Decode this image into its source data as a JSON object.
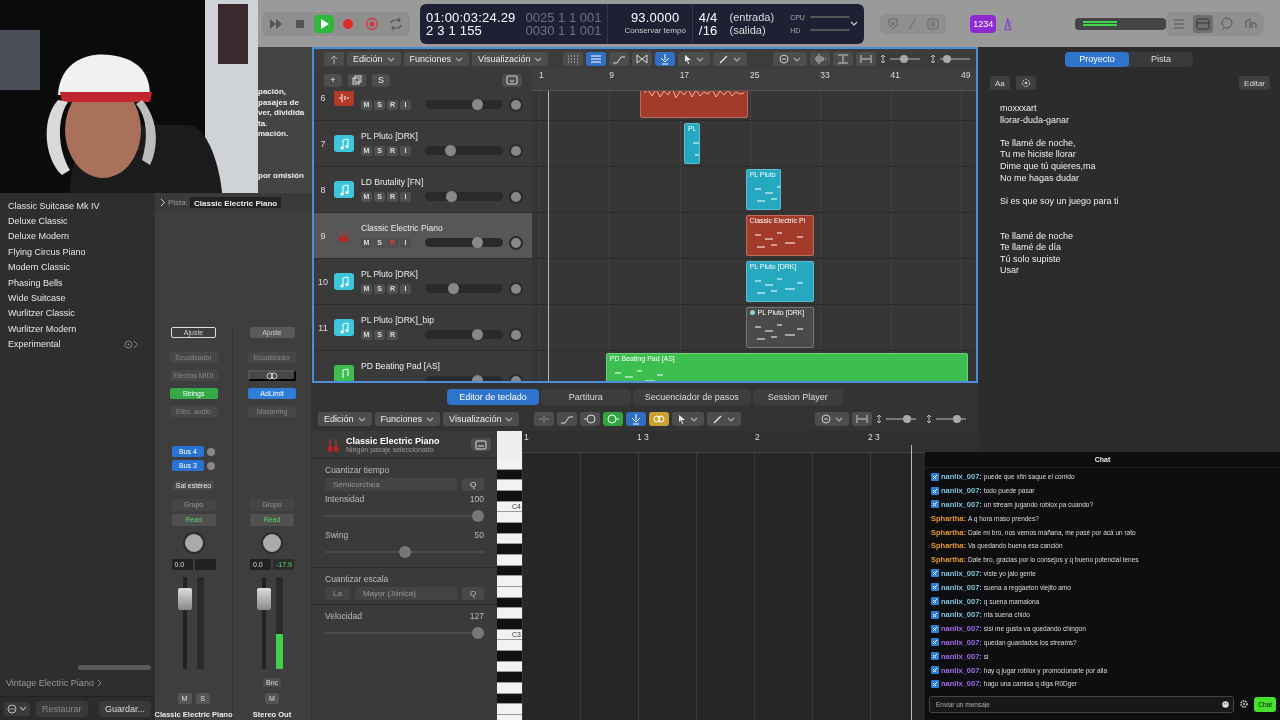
{
  "toolbar": {
    "transport": [
      {
        "kind": "forward",
        "on": false
      },
      {
        "kind": "stop",
        "on": false
      },
      {
        "kind": "play",
        "on": true
      },
      {
        "kind": "record",
        "on": false
      },
      {
        "kind": "capture",
        "on": false
      },
      {
        "kind": "cycle",
        "on": false
      }
    ],
    "lcd": {
      "time": "01:00:03:24.29",
      "position": "2 3 1 155",
      "left_locator": "0025 1 1 001",
      "right_locator": "0030 1 1 001",
      "tempo": "93.0000",
      "tempo_mode": "Conservar tempo",
      "signature": "4/4",
      "division": "/16",
      "input": "(entrada)",
      "output": "(salida)",
      "cpu_label": "CPU",
      "hd_label": "HD"
    },
    "count_in": "1234"
  },
  "library": {
    "items": [
      {
        "label": "Classic Suitcase Mk IV",
        "has_submenu": false
      },
      {
        "label": "Deluxe Classic",
        "has_submenu": false
      },
      {
        "label": "Deluxe Modern",
        "has_submenu": false
      },
      {
        "label": "Flying Circus Piano",
        "has_submenu": false
      },
      {
        "label": "Modern Classic",
        "has_submenu": false
      },
      {
        "label": "Phasing Bells",
        "has_submenu": false
      },
      {
        "label": "Wide Suitcase",
        "has_submenu": false
      },
      {
        "label": "Wurlitzer Classic",
        "has_submenu": false
      },
      {
        "label": "Wurlitzer Modern",
        "has_submenu": false
      },
      {
        "label": "Experimental",
        "has_submenu": true
      }
    ],
    "patch": "Vintage Electric Piano",
    "buttons": [
      {
        "label": "Restaurar",
        "disabled": true
      },
      {
        "label": "Guardar...",
        "disabled": false
      }
    ]
  },
  "inspector": {
    "help_fragments": [
      "pación,",
      "pasajes de",
      "ver, dividida",
      "ta.",
      "mación."
    ],
    "help_default": "por omisión",
    "track_label": "Pista:",
    "track_name": "Classic Electric Piano",
    "strips": [
      {
        "setting": {
          "label": "Ajuste",
          "selected": true
        },
        "slots": [
          {
            "kind": "slot",
            "label": "Ecualizador"
          },
          {
            "kind": "slot",
            "label": "Efectos MIDI"
          },
          {
            "kind": "plugin",
            "label": "Strings",
            "color": "#33a947"
          },
          {
            "kind": "slot",
            "label": "Efec. audio"
          }
        ],
        "sends": [
          "Bus 4",
          "Bus 3"
        ],
        "output": "Sal estéreo",
        "group": "Grupo",
        "automation": "Read",
        "volume": "0.0",
        "fader": {
          "level": 0.85
        },
        "buttons": [
          "M",
          "S"
        ],
        "name": "Classic Electric Piano"
      },
      {
        "setting": {
          "label": "Ajuste",
          "selected": false
        },
        "slots": [
          {
            "kind": "slot",
            "label": "Ecualizador"
          },
          {
            "kind": "link"
          },
          {
            "kind": "plugin",
            "label": "AdLimit",
            "color": "#2f7fd8"
          },
          {
            "kind": "slot",
            "label": "Mastering"
          }
        ],
        "group": "Grupo",
        "automation": "Read",
        "volume": "0.0",
        "peak": "-17.9",
        "fader": {
          "level": 0.85
        },
        "meter": {
          "level": 0.38
        },
        "bounce": "Bnc",
        "buttons": [
          "M"
        ],
        "name": "Stereo Out"
      }
    ]
  },
  "arrange": {
    "menus": [
      "Edición",
      "Funciones",
      "Visualización"
    ],
    "tools": [
      {
        "kind": "grid",
        "on": false
      },
      {
        "kind": "list",
        "on": true
      },
      {
        "kind": "curve",
        "on": false
      },
      {
        "kind": "flex",
        "on": false
      },
      {
        "kind": "snap",
        "on": true
      }
    ],
    "zoom": {
      "vertical": {
        "level": 0.45
      },
      "horizontal": {
        "level": 0.15
      }
    },
    "header_buttons": [
      "+",
      "S"
    ],
    "ruler": [
      "1",
      "9",
      "17",
      "25",
      "33",
      "41",
      "49"
    ],
    "tracks": [
      {
        "number": "6",
        "kind": "audio",
        "selected": false,
        "buttons": [
          {
            "label": "M",
            "on": false
          },
          {
            "label": "S",
            "on": false
          },
          {
            "label": "R",
            "on": false
          },
          {
            "label": "I",
            "on": false
          }
        ],
        "level": 0.7,
        "regions": [
          {
            "kind": "audio",
            "color": "#a33b2b"
          }
        ]
      },
      {
        "number": "7",
        "name": "PL Pluto [DRK]",
        "kind": "software",
        "selected": false,
        "buttons": [
          {
            "label": "M",
            "on": false
          },
          {
            "label": "S",
            "on": false
          },
          {
            "label": "R",
            "on": false
          },
          {
            "label": "I",
            "on": false
          }
        ],
        "level": 0.3,
        "regions": [
          {
            "kind": "midi",
            "label": "PL",
            "color": "#26a9c0"
          }
        ]
      },
      {
        "number": "8",
        "name": "LD Brutality [FN]",
        "kind": "software",
        "selected": false,
        "buttons": [
          {
            "label": "M",
            "on": false
          },
          {
            "label": "S",
            "on": false
          },
          {
            "label": "R",
            "on": false
          },
          {
            "label": "I",
            "on": false
          }
        ],
        "level": 0.31,
        "regions": [
          {
            "kind": "midi",
            "label": "PL Pluto",
            "color": "#26a9c0"
          }
        ]
      },
      {
        "number": "9",
        "name": "Classic Electric Piano",
        "kind": "strings",
        "selected": true,
        "buttons": [
          {
            "label": "M",
            "on": false
          },
          {
            "label": "S",
            "on": false
          },
          {
            "label": "R",
            "on": true
          },
          {
            "label": "I",
            "on": false
          }
        ],
        "level": 0.7,
        "regions": [
          {
            "kind": "midi",
            "label": "Classic Electric Pi",
            "color": "#a33b2b"
          }
        ]
      },
      {
        "number": "10",
        "name": "PL Pluto [DRK]",
        "kind": "software",
        "selected": false,
        "buttons": [
          {
            "label": "M",
            "on": false
          },
          {
            "label": "S",
            "on": false
          },
          {
            "label": "R",
            "on": false
          },
          {
            "label": "I",
            "on": false
          }
        ],
        "level": 0.35,
        "regions": [
          {
            "kind": "midi",
            "label": "PL Pluto [DRK]",
            "color": "#26a9c0"
          }
        ]
      },
      {
        "number": "11",
        "name": "PL Pluto [DRK]_bip",
        "kind": "software",
        "selected": false,
        "buttons": [
          {
            "label": "M",
            "on": false
          },
          {
            "label": "S",
            "on": false
          },
          {
            "label": "R",
            "on": false
          }
        ],
        "level": 0.7,
        "regions": [
          {
            "kind": "alias",
            "label": "PL Pluto [DRK]",
            "color": "#4a4a4a"
          }
        ]
      },
      {
        "name": "PD Beating Pad [AS]",
        "kind": "pad",
        "selected": false,
        "level": 0.7,
        "regions": [
          {
            "kind": "midi",
            "label": "PD Beating Pad [AS]",
            "color": "#3cbf4e"
          }
        ]
      }
    ]
  },
  "editor": {
    "tabs": [
      {
        "label": "Editor de teclado",
        "selected": true
      },
      {
        "label": "Partitura",
        "selected": false
      },
      {
        "label": "Secuenciador de pasos",
        "selected": false
      },
      {
        "label": "Session Player",
        "selected": false
      }
    ],
    "menus": [
      "Edición",
      "Funciones",
      "Visualización"
    ],
    "tools": [
      {
        "kind": "collapse",
        "on": false
      },
      {
        "kind": "curve",
        "on": false
      },
      {
        "kind": "midi_out",
        "on": false
      },
      {
        "kind": "midi_in",
        "on": true
      },
      {
        "kind": "snap",
        "on": true
      },
      {
        "kind": "link",
        "on": true
      }
    ],
    "zoom": {
      "vertical": {
        "level": 0.75
      },
      "horizontal": {
        "level": 0.75
      }
    },
    "instrument": "Classic Electric Piano",
    "status": "Ningún pasaje seleccionado",
    "quantize_label": "Cuantizar tiempo",
    "quantize_value": "Semicorchea",
    "quantize_button": "Q",
    "sliders": [
      {
        "label": "Intensidad",
        "reading": "100",
        "level": 1
      },
      {
        "label": "Swing",
        "reading": "50",
        "level": 0.5
      }
    ],
    "scale_label": "Cuantizar escala",
    "scale_root": "La",
    "scale_mode": "Mayor (Jónica)",
    "scale_button": "Q",
    "velocity": {
      "label": "Velocidad",
      "reading": "127",
      "level": 1
    },
    "key_labels": [
      "C4",
      "C3"
    ],
    "ruler": [
      "1",
      "1 3",
      "2",
      "2 3"
    ]
  },
  "notes": {
    "tabs": [
      {
        "label": "Proyecto",
        "selected": true
      },
      {
        "label": "Pista",
        "selected": false
      }
    ],
    "font_button": "Aa",
    "edit_button": "Editar",
    "lyrics": [
      {
        "kind": "text",
        "text": "moxxxart"
      },
      {
        "kind": "text",
        "text": "llorar-duda-ganar"
      },
      {
        "kind": "blank"
      },
      {
        "kind": "text",
        "text": "Te llamé de noche,"
      },
      {
        "kind": "text",
        "text": "Tu me hiciste llorar"
      },
      {
        "kind": "text",
        "text": "Dime que tú quieres,ma"
      },
      {
        "kind": "text",
        "text": "No me hagas dudar"
      },
      {
        "kind": "blank"
      },
      {
        "kind": "text",
        "text": "Si es que soy un juego para ti"
      },
      {
        "kind": "blank"
      },
      {
        "kind": "blank"
      },
      {
        "kind": "text",
        "text": "Te llamé de noche"
      },
      {
        "kind": "text",
        "text": "Te llamé de día"
      },
      {
        "kind": "text",
        "text": "Tú solo supiste"
      },
      {
        "kind": "text",
        "text": "Usar"
      }
    ]
  },
  "chat": {
    "title": "Chat",
    "messages": [
      {
        "user": "nanlix_007:",
        "color": "#7fc6dc",
        "badge": true,
        "text": "puede que xfin saque el corrido"
      },
      {
        "user": "nanlix_007:",
        "color": "#7fc6dc",
        "badge": true,
        "text": "todo puede pasar"
      },
      {
        "user": "nanlix_007:",
        "color": "#7fc6dc",
        "badge": true,
        "text": "un stream jugando roblox pa cuando?"
      },
      {
        "user": "Sphartha:",
        "color": "#e69a2e",
        "badge": false,
        "text": "A q hora maso prendes?"
      },
      {
        "user": "Sphartha:",
        "color": "#e69a2e",
        "badge": false,
        "text": "Dale mi bro, nos vemos mañana, me pasé por acá un rato"
      },
      {
        "user": "Sphartha:",
        "color": "#e69a2e",
        "badge": false,
        "text": "Va quedando buena esa canción"
      },
      {
        "user": "Sphartha:",
        "color": "#e69a2e",
        "badge": false,
        "text": "Dale bro, gracias por lo consejos y q bueno potencial tenes"
      },
      {
        "user": "nanlix_007:",
        "color": "#7fc6dc",
        "badge": true,
        "text": "viste yo jalo gente"
      },
      {
        "user": "nanlix_007:",
        "color": "#7fc6dc",
        "badge": true,
        "text": "suena a reggaeton viejito amo"
      },
      {
        "user": "nanlix_007:",
        "color": "#7fc6dc",
        "badge": true,
        "text": "q suena mamalona"
      },
      {
        "user": "nanlix_007:",
        "color": "#7fc6dc",
        "badge": true,
        "text": "nta suena chido"
      },
      {
        "user": "nanlix_007:",
        "color": "#a46cf0",
        "badge": true,
        "text": "sisi me gusta va quedando chingon"
      },
      {
        "user": "nanlix_007:",
        "color": "#a46cf0",
        "badge": true,
        "text": "quedan guardados los streams?"
      },
      {
        "user": "nanlix_007:",
        "color": "#a46cf0",
        "badge": true,
        "text": "si"
      },
      {
        "user": "nanlix_007:",
        "color": "#a46cf0",
        "badge": true,
        "text": "hay q jugar roblox y promocionarte por alla"
      },
      {
        "user": "nanlix_007:",
        "color": "#a46cf0",
        "badge": true,
        "text": "hago una camisa q diga R0Dger"
      }
    ],
    "placeholder": "Enviar un mensaje",
    "send": "Chat"
  }
}
